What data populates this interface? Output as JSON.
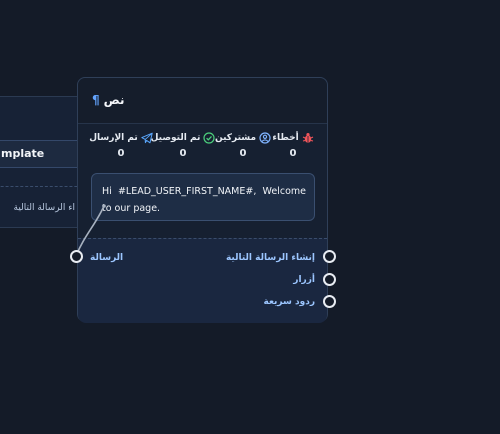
{
  "left_node": {
    "title": "mplate",
    "next_label": "اء الرسالة التالية"
  },
  "node": {
    "title": "نص",
    "title_icon": "pilcrow-icon",
    "stats": [
      {
        "key": "errors",
        "label": "أخطاء",
        "icon": "bug-icon",
        "value": "0",
        "color": "#f2555a"
      },
      {
        "key": "subscribers",
        "label": "مشتركين",
        "icon": "user-circle-icon",
        "value": "0",
        "color": "#7fb3ff"
      },
      {
        "key": "delivered",
        "label": "تم التوصيل",
        "icon": "check-circle-icon",
        "value": "0",
        "color": "#4cd07d"
      },
      {
        "key": "sent",
        "label": "تم الإرسال",
        "icon": "telegram-send-icon",
        "value": "0",
        "color": "#5aa8ff"
      }
    ],
    "message_text": "Hi #LEAD_USER_FIRST_NAME#, Welcome to our page.",
    "input_label": "الرسالة",
    "outputs": [
      {
        "label": "إنشاء الرسالة التالية"
      },
      {
        "label": "أزرار"
      },
      {
        "label": "ردود سريعة"
      }
    ]
  },
  "colors": {
    "canvas": "#141b28",
    "node": "#162031",
    "accent": "#63a4ff",
    "port_label": "#9cc6ff"
  }
}
